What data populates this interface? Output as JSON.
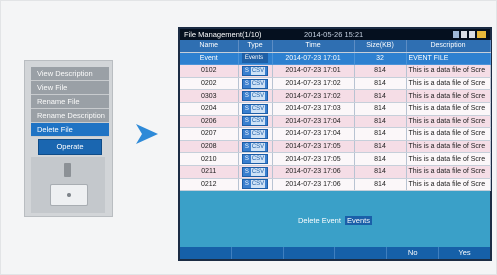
{
  "menu": {
    "items": [
      {
        "label": "View Description",
        "selected": false
      },
      {
        "label": "View File",
        "selected": false
      },
      {
        "label": "Rename File",
        "selected": false
      },
      {
        "label": "Rename Description",
        "selected": false
      },
      {
        "label": "Delete File",
        "selected": true
      }
    ],
    "operate_label": "Operate"
  },
  "screen": {
    "title": "File Management(1/10)",
    "datetime": "2014-05-26 15:21",
    "columns": [
      "Name",
      "Type",
      "Time",
      "Size(KB)",
      "Description"
    ],
    "rows": [
      {
        "name": "Event",
        "type": "Events",
        "time": "2014-07-23 17:01",
        "size": "32",
        "description": "EVENT FILE",
        "selected": true
      },
      {
        "name": "0102",
        "type": "S",
        "time": "2014-07-23 17:01",
        "size": "814",
        "description": "This is a data file of Scre"
      },
      {
        "name": "0202",
        "type": "S",
        "time": "2014-07-23 17:02",
        "size": "814",
        "description": "This is a data file of Scre"
      },
      {
        "name": "0303",
        "type": "S",
        "time": "2014-07-23 17:02",
        "size": "814",
        "description": "This is a data file of Scre"
      },
      {
        "name": "0204",
        "type": "S",
        "time": "2014-07-23 17:03",
        "size": "814",
        "description": "This is a data file of Scre"
      },
      {
        "name": "0206",
        "type": "S",
        "time": "2014-07-23 17:04",
        "size": "814",
        "description": "This is a data file of Scre"
      },
      {
        "name": "0207",
        "type": "S",
        "time": "2014-07-23 17:04",
        "size": "814",
        "description": "This is a data file of Scre"
      },
      {
        "name": "0208",
        "type": "S",
        "time": "2014-07-23 17:05",
        "size": "814",
        "description": "This is a data file of Scre"
      },
      {
        "name": "0210",
        "type": "S",
        "time": "2014-07-23 17:05",
        "size": "814",
        "description": "This is a data file of Scre"
      },
      {
        "name": "0211",
        "type": "S",
        "time": "2014-07-23 17:06",
        "size": "814",
        "description": "This is a data file of Scre"
      },
      {
        "name": "0212",
        "type": "S",
        "time": "2014-07-23 17:06",
        "size": "814",
        "description": "This is a data file of Scre"
      }
    ],
    "type_chip": "CSV",
    "delete_prompt": "Delete Event",
    "delete_target": "Events",
    "softkeys": [
      "",
      "",
      "",
      "",
      "No",
      "Yes"
    ]
  },
  "colors": {
    "accent_blue": "#1f73c4",
    "header_blue": "#2f6fb2",
    "dialog_teal": "#3aa0c8",
    "row_pink": "#f5dde6"
  }
}
